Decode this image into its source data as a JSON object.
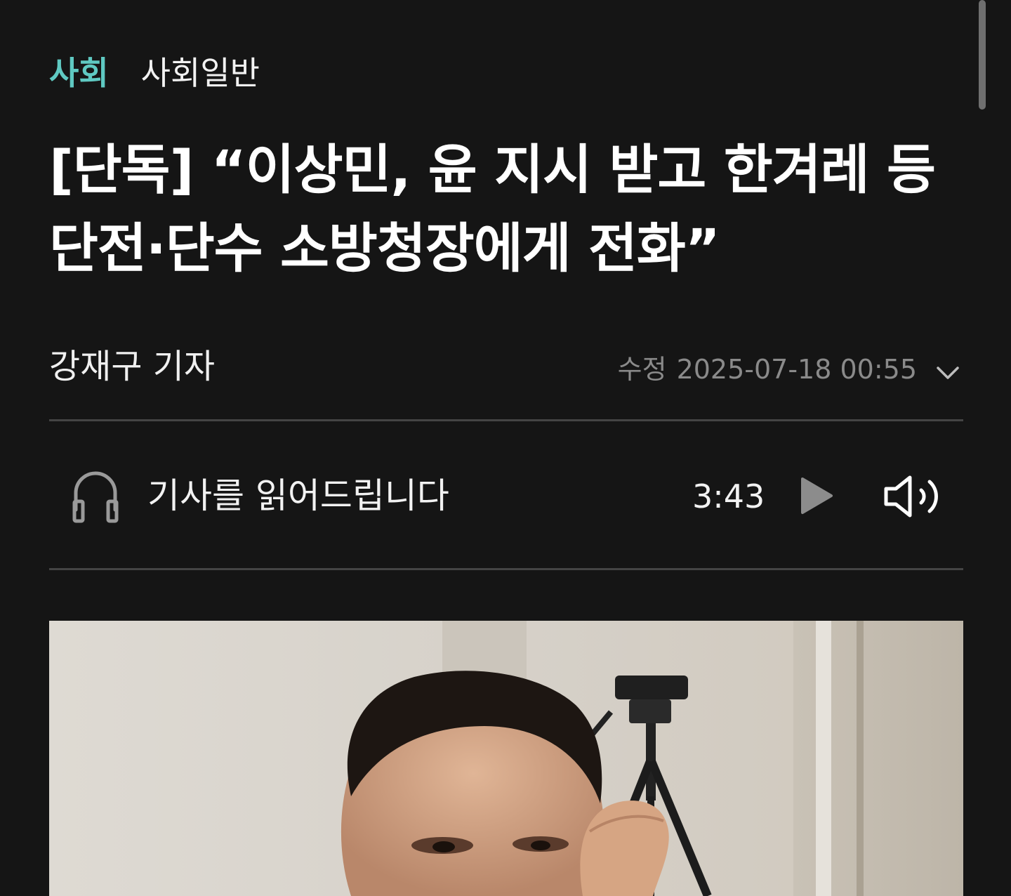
{
  "breadcrumb": {
    "section": "사회",
    "subsection": "사회일반"
  },
  "article": {
    "headline": "[단독] “이상민, 윤 지시 받고 한겨레 등 단전·단수 소방청장에게 전화”",
    "reporter": "강재구 기자",
    "date_label": "수정",
    "date_value": "2025-07-18 00:55"
  },
  "tts": {
    "label": "기사를 읽어드립니다",
    "duration": "3:43",
    "icons": [
      "headphones-icon",
      "play-icon",
      "volume-icon",
      "chevron-down-icon"
    ]
  },
  "colors": {
    "background": "#151515",
    "section_accent": "#5fc9c2",
    "muted_text": "#8a8a8a",
    "divider": "#444444"
  }
}
